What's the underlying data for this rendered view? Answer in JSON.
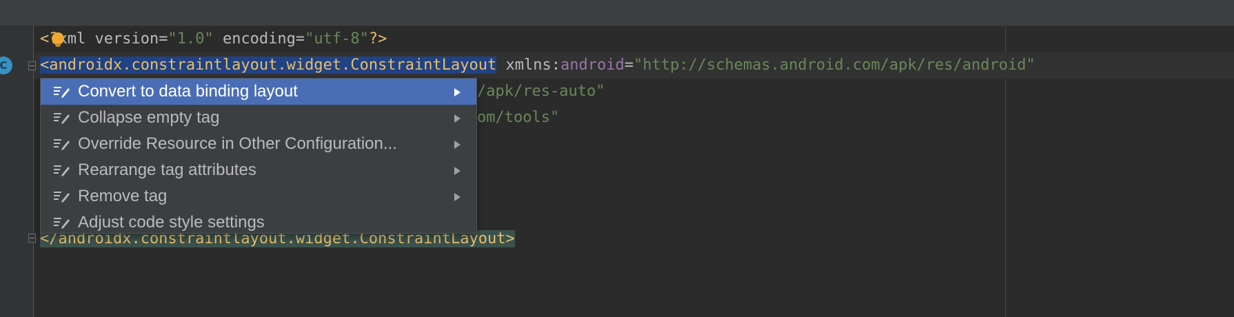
{
  "editor": {
    "line1": {
      "open": "<?",
      "name": "xml",
      "attr1": " version",
      "eq1": "=",
      "val1": "\"1.0\"",
      "attr2": " encoding",
      "eq2": "=",
      "val2": "\"utf-8\"",
      "close": "?>"
    },
    "line2": {
      "tag": "<androidx.constraintlayout.widget.ConstraintLayout",
      "attr": " xmlns",
      "colon": ":",
      "ns": "android",
      "eq": "=",
      "val": "\"http://schemas.android.com/apk/res/android\""
    },
    "line3": {
      "tail": "/apk/res-auto\""
    },
    "line4": {
      "tail": "om/tools\""
    },
    "close_tag": "</androidx.constraintlayout.widget.ConstraintLayout>",
    "gutter_badge": "C"
  },
  "intention_menu": {
    "items": [
      {
        "label": "Convert to data binding layout",
        "icon": "edit-intention-icon",
        "has_submenu": true,
        "active": true
      },
      {
        "label": "Collapse empty tag",
        "icon": "edit-intention-icon",
        "has_submenu": true,
        "active": false
      },
      {
        "label": "Override Resource in Other Configuration...",
        "icon": "edit-intention-icon",
        "has_submenu": true,
        "active": false
      },
      {
        "label": "Rearrange tag attributes",
        "icon": "edit-intention-icon",
        "has_submenu": true,
        "active": false
      },
      {
        "label": "Remove tag",
        "icon": "edit-intention-icon",
        "has_submenu": true,
        "active": false
      },
      {
        "label": "Adjust code style settings",
        "icon": "edit-intention-icon",
        "has_submenu": false,
        "active": false
      }
    ]
  },
  "colors": {
    "background": "#2b2b2b",
    "gutter": "#313335",
    "selection": "#214283",
    "menu_active": "#4a6eb5",
    "tag": "#e8bf6a",
    "string": "#6a8759",
    "namespace": "#9876aa"
  }
}
